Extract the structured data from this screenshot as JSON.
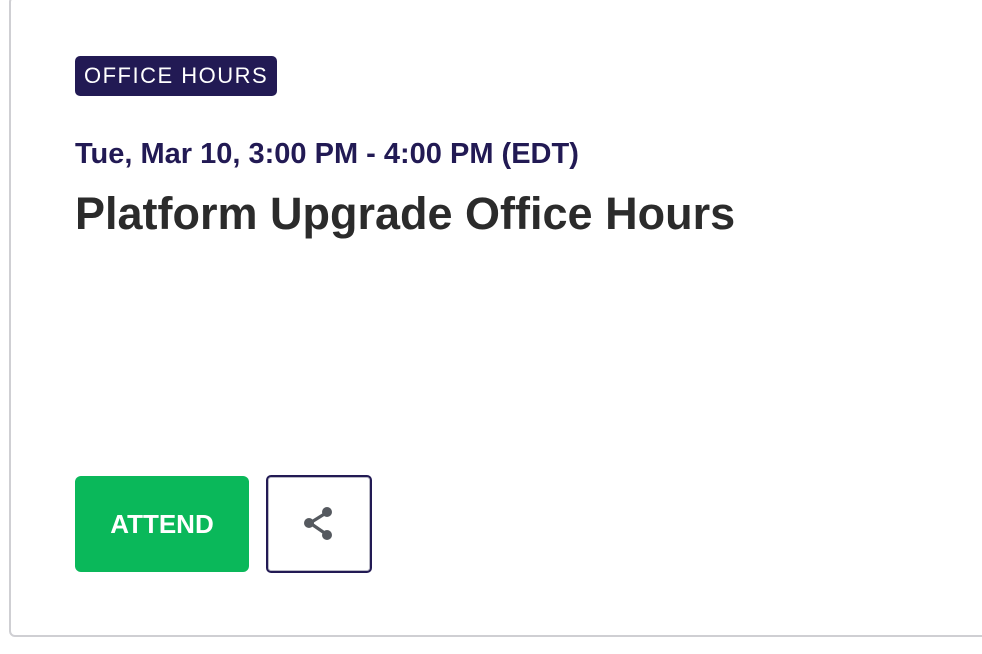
{
  "event": {
    "badge": "OFFICE HOURS",
    "datetime": "Tue, Mar 10, 3:00 PM - 4:00 PM (EDT)",
    "title": "Platform Upgrade Office Hours"
  },
  "actions": {
    "attend_label": "ATTEND",
    "share_icon": "share-icon"
  },
  "colors": {
    "badge_bg": "#221a54",
    "datetime": "#221a54",
    "attend_bg": "#0ab85a",
    "share_icon": "#55595f"
  }
}
